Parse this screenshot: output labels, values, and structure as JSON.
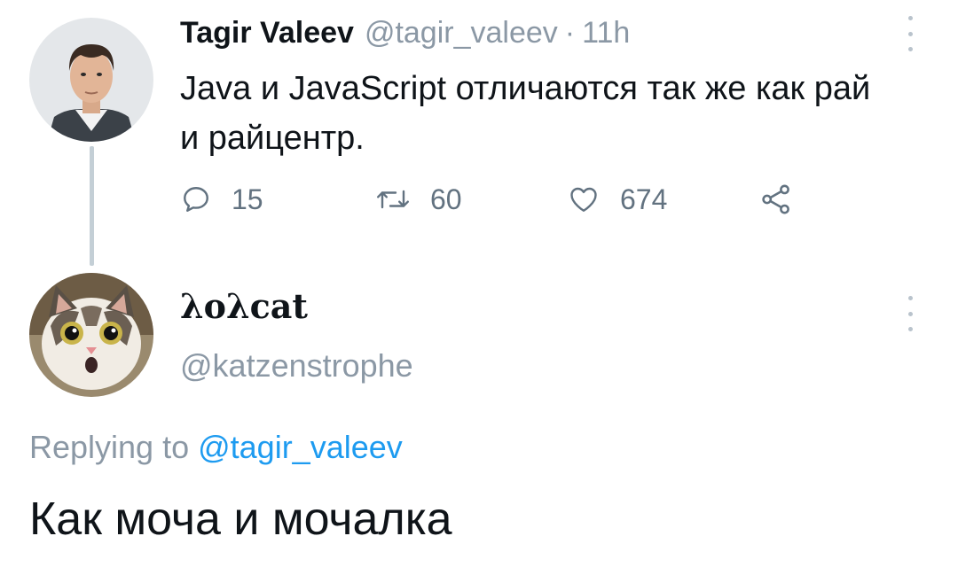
{
  "parent_tweet": {
    "display_name": "Tagir Valeev",
    "handle": "@tagir_valeev",
    "separator": "·",
    "time": "11h",
    "text_line1": "Java и JavaScript отличаются так же как рай",
    "text_line2": "и райцентр.",
    "avatar_icon": "user-photo",
    "actions": {
      "reply_count": "15",
      "retweet_count": "60",
      "like_count": "674"
    }
  },
  "reply_tweet": {
    "display_name": "λoλcat",
    "handle": "@katzenstrophe",
    "avatar_icon": "cat-photo",
    "replying_prefix": "Replying to ",
    "replying_mention": "@tagir_valeev",
    "text": "Как моча и мочалка"
  },
  "colors": {
    "text_primary": "#0f1419",
    "text_secondary": "#8b98a5",
    "accent": "#1d9bf0",
    "thread_line": "#c4cfd6"
  }
}
